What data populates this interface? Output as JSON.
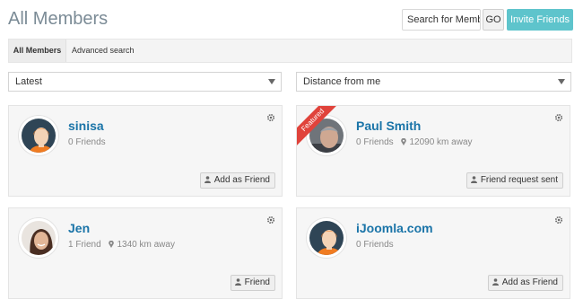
{
  "header": {
    "title": "All Members",
    "search_value": "Search for Memb",
    "go_label": "GO",
    "invite_label": "Invite Friends"
  },
  "tabs": [
    {
      "label": "All Members",
      "active": true
    },
    {
      "label": "Advanced search",
      "active": false
    }
  ],
  "filters": {
    "sort_selected": "Latest",
    "distance_selected": "Distance from me"
  },
  "members": [
    {
      "name": "sinisa",
      "friends": "0 Friends",
      "distance": "",
      "featured": false,
      "action": "Add as Friend",
      "avatar": "default-avatar-icon"
    },
    {
      "name": "Paul Smith",
      "friends": "0 Friends",
      "distance": "12090 km away",
      "featured": true,
      "featured_label": "Featured",
      "action": "Friend request sent",
      "avatar": "photo-avatar"
    },
    {
      "name": "Jen",
      "friends": "1 Friend",
      "distance": "1340 km away",
      "featured": false,
      "action": "Friend",
      "avatar": "photo-avatar"
    },
    {
      "name": "iJoomla.com",
      "friends": "0 Friends",
      "distance": "",
      "featured": false,
      "action": "Add as Friend",
      "avatar": "default-avatar-icon"
    }
  ],
  "colors": {
    "accent": "#5ec4cc",
    "link": "#1a74a8",
    "featured": "#e0433b",
    "avatar_bg": "#2f4556",
    "avatar_hair": "#f07c22"
  }
}
